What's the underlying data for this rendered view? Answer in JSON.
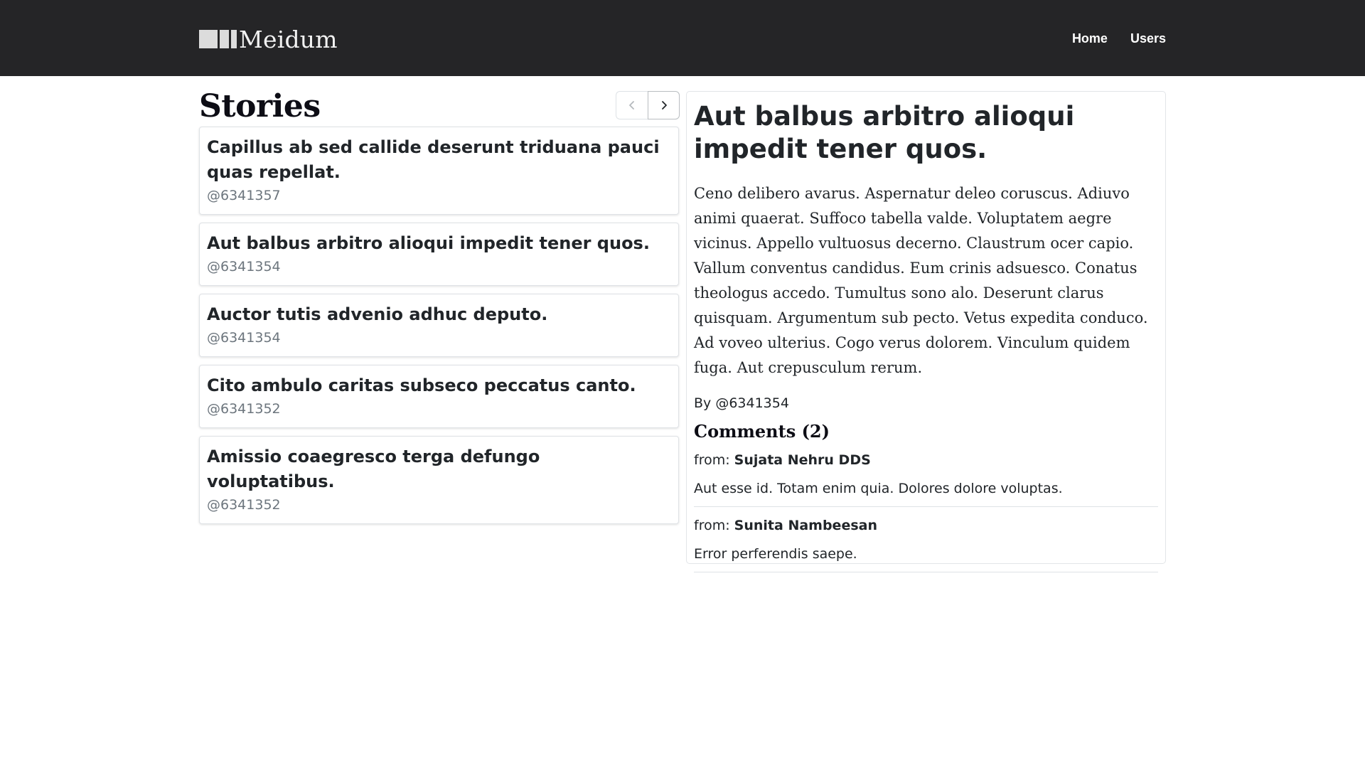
{
  "header": {
    "brand": "Meidum",
    "nav": [
      {
        "label": "Home"
      },
      {
        "label": "Users"
      }
    ]
  },
  "stories": {
    "heading": "Stories",
    "pagination": {
      "prev_icon": "chevron-left-icon",
      "next_icon": "chevron-right-icon"
    },
    "items": [
      {
        "title": "Capillus ab sed callide deserunt triduana pauci quas repellat.",
        "author": "@6341357"
      },
      {
        "title": "Aut balbus arbitro alioqui impedit tener quos.",
        "author": "@6341354"
      },
      {
        "title": "Auctor tutis advenio adhuc deputo.",
        "author": "@6341354"
      },
      {
        "title": "Cito ambulo caritas subseco peccatus canto.",
        "author": "@6341352"
      },
      {
        "title": "Amissio coaegresco terga defungo voluptatibus.",
        "author": "@6341352"
      }
    ]
  },
  "detail": {
    "title": "Aut balbus arbitro alioqui impedit tener quos.",
    "body": "Ceno delibero avarus. Aspernatur deleo coruscus. Adiuvo animi quaerat. Suffoco tabella valde. Voluptatem aegre vicinus. Appello vultuosus decerno. Claustrum ocer capio. Vallum conventus candidus. Eum crinis adsuesco. Conatus theologus accedo. Tumultus sono alo. Deserunt clarus quisquam. Argumentum sub pecto. Vetus expedita conduco. Ad voveo ulterius. Cogo verus dolorem. Vinculum quidem fuga. Aut crepusculum rerum.",
    "byline": "By @6341354",
    "comments_heading": "Comments (2)",
    "comments": [
      {
        "from_label": "from:",
        "author": "Sujata Nehru DDS",
        "text": "Aut esse id. Totam enim quia. Dolores dolore voluptas."
      },
      {
        "from_label": "from:",
        "author": "Sunita Nambeesan",
        "text": "Error perferendis saepe."
      }
    ]
  },
  "colors": {
    "navbar_bg": "#252527",
    "muted_text": "#6c757d",
    "border": "#dee2e6"
  }
}
